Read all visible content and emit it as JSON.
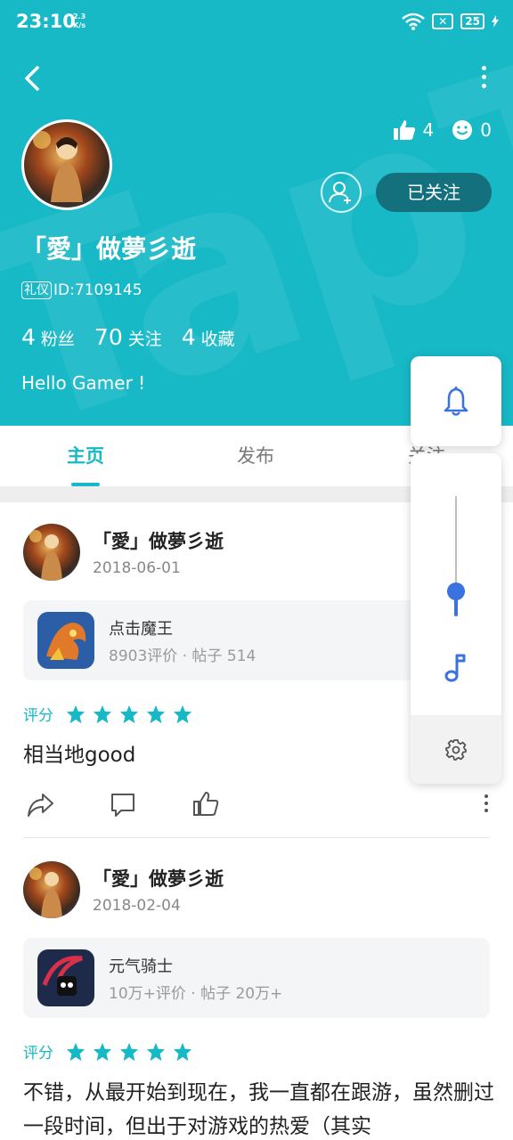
{
  "status_bar": {
    "time": "23:10",
    "speed_value": "2.3",
    "speed_unit": "K/s",
    "battery": "25"
  },
  "profile": {
    "username": "「愛」做夢彡逝",
    "id_badge": "礼仪",
    "id_text": "ID:7109145",
    "likes_count": "4",
    "smiles_count": "0",
    "follow_button": "已关注",
    "stats": [
      {
        "num": "4",
        "label": "粉丝"
      },
      {
        "num": "70",
        "label": "关注"
      },
      {
        "num": "4",
        "label": "收藏"
      }
    ],
    "bio": "Hello Gamer !"
  },
  "tabs": [
    {
      "label": "主页"
    },
    {
      "label": "发布"
    },
    {
      "label": "关注"
    }
  ],
  "posts": [
    {
      "author": "「愛」做夢彡逝",
      "date": "2018-06-01",
      "game_name": "点击魔王",
      "game_meta": "8903评价 · 帖子 514",
      "rating_label": "评分",
      "rating": 5,
      "text": "相当地good"
    },
    {
      "author": "「愛」做夢彡逝",
      "date": "2018-02-04",
      "game_name": "元气骑士",
      "game_meta": "10万+评价 · 帖子 20万+",
      "rating_label": "评分",
      "rating": 5,
      "text": "不错，从最开始到现在，我一直都在跟游，虽然删过一段时间，但出于对游戏的热爱（其实"
    }
  ],
  "colors": {
    "accent": "#17b9c7",
    "follow_btn": "#14707d",
    "volume_blue": "#3b72e0"
  },
  "icons": [
    "back-icon",
    "more-icon",
    "thumbs-up-icon",
    "smile-icon",
    "add-friend-icon",
    "star-icon",
    "share-icon",
    "comment-icon",
    "like-icon",
    "bell-icon",
    "music-note-icon",
    "settings-icon"
  ]
}
